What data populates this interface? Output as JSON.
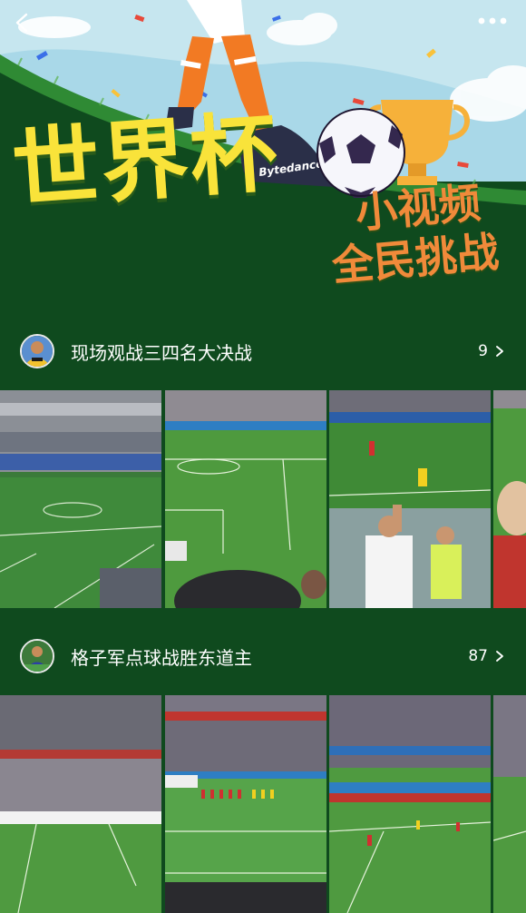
{
  "banner": {
    "title": "世界杯",
    "subtitle_line1": "小视频",
    "subtitle_line2": "全民挑战",
    "shoe_brand": "Bytedance",
    "colors": {
      "bg": "#0f4a1e",
      "title_yellow": "#f9e33a",
      "subtitle_orange": "#f08a3a"
    }
  },
  "nav": {
    "back_icon": "chevron-left-icon",
    "more_icon": "more-dots-icon"
  },
  "sections": [
    {
      "title": "现场观战三四名大决战",
      "count": "9"
    },
    {
      "title": "格子军点球战胜东道主",
      "count": "87"
    }
  ]
}
